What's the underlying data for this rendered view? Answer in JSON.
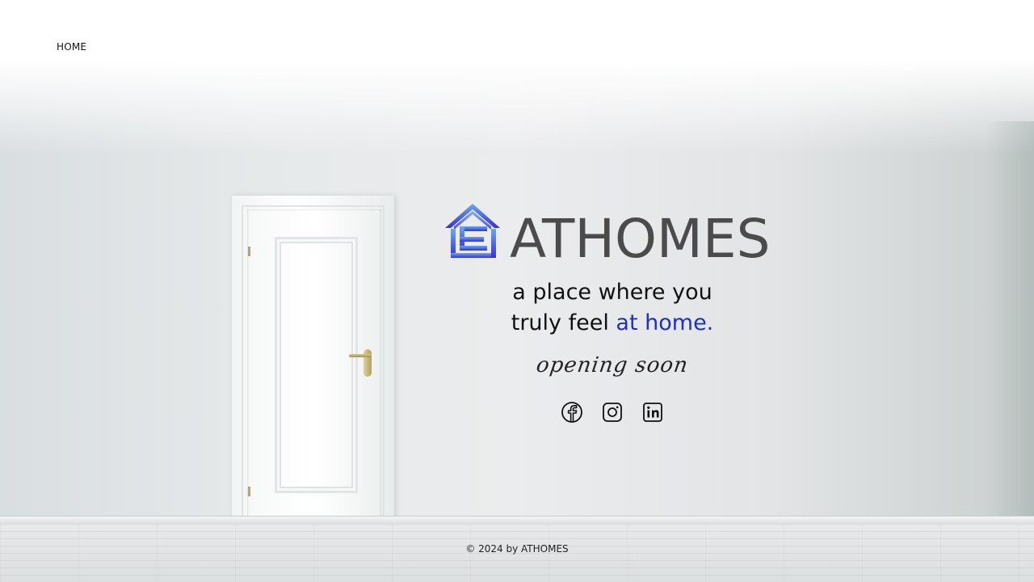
{
  "nav": {
    "home_label": "HOME"
  },
  "brand": {
    "name": "ATHOMES",
    "logo_icon": "house-e-logo-icon",
    "logo_colors": [
      "#5b8ee6",
      "#3b2fd8"
    ]
  },
  "hero": {
    "tagline_line1": "a place where you",
    "tagline_line2_prefix": "truly feel ",
    "tagline_line2_accent": "at home.",
    "accent_color": "#1f2fc4",
    "status": "opening soon"
  },
  "social": {
    "icons": [
      "facebook-icon",
      "instagram-icon",
      "linkedin-icon"
    ]
  },
  "footer": {
    "copyright": "© 2024 by ATHOMES"
  }
}
